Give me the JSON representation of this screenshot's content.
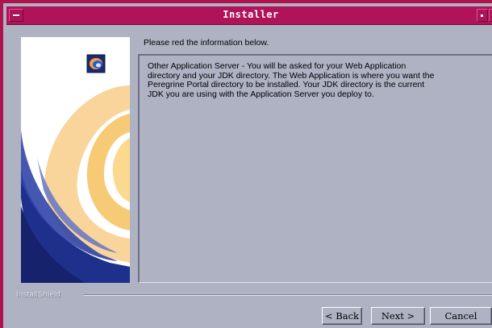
{
  "window": {
    "title": "Installer"
  },
  "header": {
    "text": "Please red the information below."
  },
  "body": {
    "text": "Other Application Server - You will be asked for your Web Application\ndirectory and your JDK directory. The Web Application is where you want the\nPeregrine Portal directory to be installed. Your JDK directory is the current\nJDK you are using with the Application Server you deploy to."
  },
  "footer": {
    "brand": "InstallShield"
  },
  "buttons": {
    "back": "< Back",
    "next": "Next >",
    "cancel": "Cancel"
  },
  "colors": {
    "titlebar": "#b0135a",
    "background": "#aeb2c3",
    "artwork_blue": "#2b3f9e",
    "artwork_orange": "#f2a23c"
  }
}
